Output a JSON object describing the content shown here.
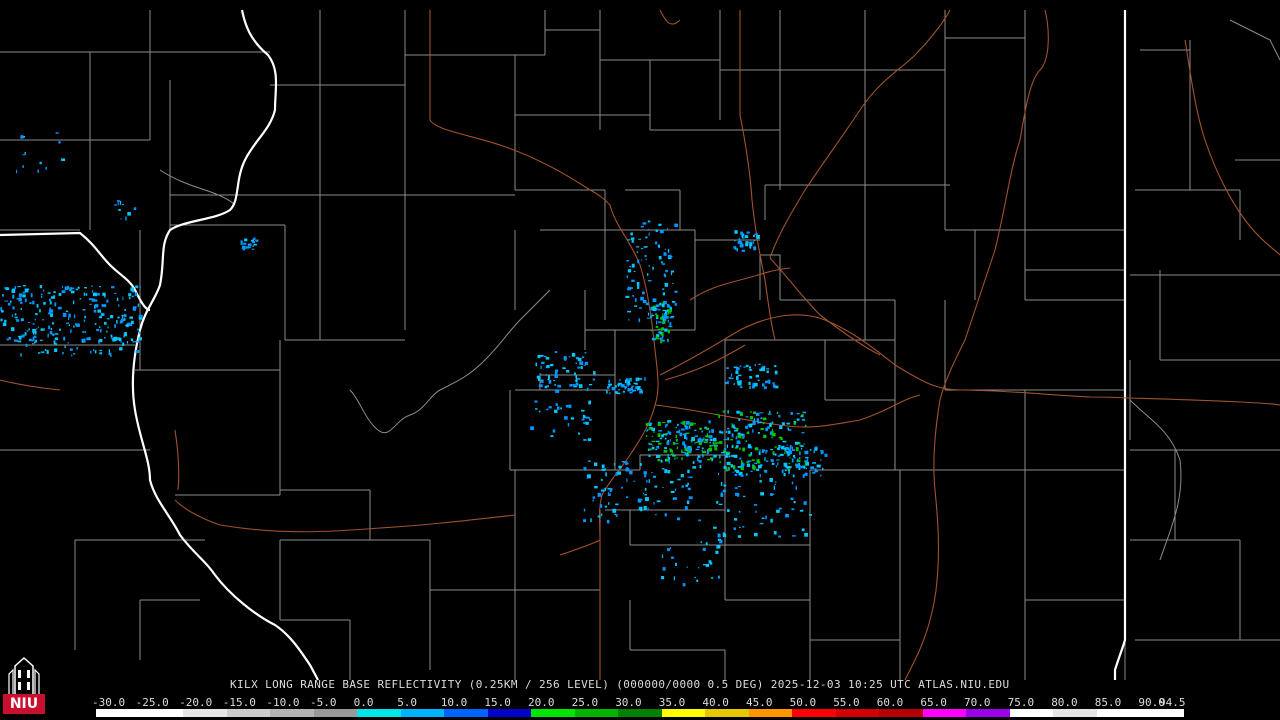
{
  "title": "KILX LONG RANGE BASE REFLECTIVITY (0.25KM / 256 LEVEL) (000000/0000 0.5 DEG) 2025-12-03 10:25 UTC  ATLAS.NIU.EDU",
  "logo": {
    "text": "NIU"
  },
  "scale": {
    "labels": [
      "-30.0",
      "-25.0",
      "-20.0",
      "-15.0",
      "-10.0",
      "-5.0",
      "0.0",
      "5.0",
      "10.0",
      "15.0",
      "20.0",
      "25.0",
      "30.0",
      "35.0",
      "40.0",
      "45.0",
      "50.0",
      "55.0",
      "60.0",
      "65.0",
      "70.0",
      "75.0",
      "80.0",
      "85.0",
      "90.0",
      "94.5"
    ],
    "colors": [
      "#ffffff",
      "#ffffff",
      "#e6e6e6",
      "#cccccc",
      "#b3b3b3",
      "#999999",
      "#00e5e5",
      "#00b4ff",
      "#0064ff",
      "#0000c8",
      "#00e600",
      "#00b400",
      "#008200",
      "#ffff00",
      "#e6c800",
      "#ff9600",
      "#ff0000",
      "#d20000",
      "#b40000",
      "#ff00ff",
      "#9b00e6",
      "#ffffff",
      "#e6e6e6",
      "#ffffff",
      "#ffffff"
    ]
  },
  "colors": {
    "background": "#000000",
    "county_lines": "#8c8c8c",
    "state_lines": "#ffffff",
    "roads": "#a0522d",
    "echo_light": "#00c8ff",
    "echo_mid": "#0096ff",
    "echo_strong": "#00c800"
  }
}
